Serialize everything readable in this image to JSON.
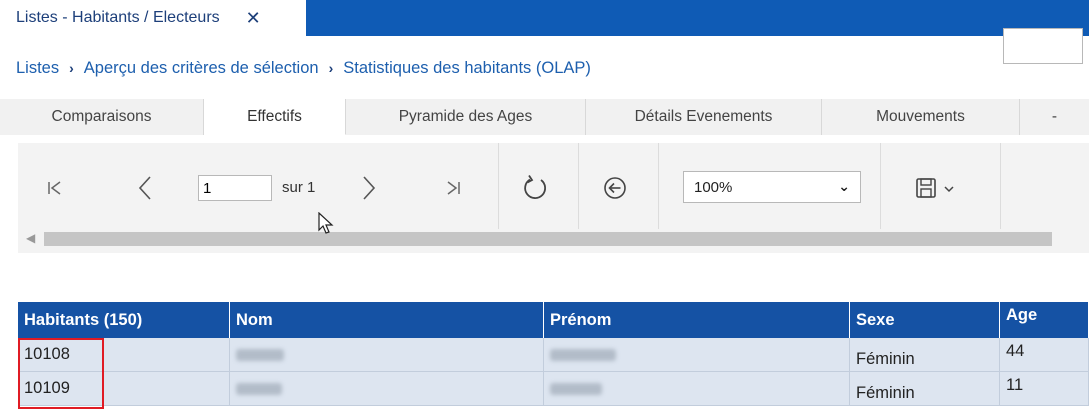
{
  "window_tab": {
    "title": "Listes - Habitants / Electeurs",
    "close": "✕"
  },
  "breadcrumb": [
    "Listes",
    "Aperçu des critères de sélection",
    "Statistiques des habitants (OLAP)"
  ],
  "breadcrumb_sep": "›",
  "tabs": [
    {
      "label": "Comparaisons"
    },
    {
      "label": "Effectifs",
      "active": true
    },
    {
      "label": "Pyramide des Ages"
    },
    {
      "label": "Détails Evenements"
    },
    {
      "label": "Mouvements"
    },
    {
      "label": "-"
    }
  ],
  "toolbar": {
    "first_icon": "first-page-icon",
    "prev_icon": "previous-page-icon",
    "page_value": "1",
    "page_of": "sur 1",
    "next_icon": "next-page-icon",
    "last_icon": "last-page-icon",
    "refresh_icon": "refresh-icon",
    "back_icon": "back-icon",
    "zoom": "100%",
    "save_icon": "save-icon"
  },
  "table": {
    "columns": [
      "Habitants (150)",
      "Nom",
      "Prénom",
      "Sexe",
      "Age"
    ],
    "rows": [
      {
        "id": "10108",
        "sexe": "Féminin",
        "age": "44"
      },
      {
        "id": "10109",
        "sexe": "Féminin",
        "age": "11"
      }
    ]
  },
  "colors": {
    "accent": "#0f5bb5",
    "header": "#1552a4",
    "row": "#dde5f0",
    "highlight": "#e01b24"
  }
}
